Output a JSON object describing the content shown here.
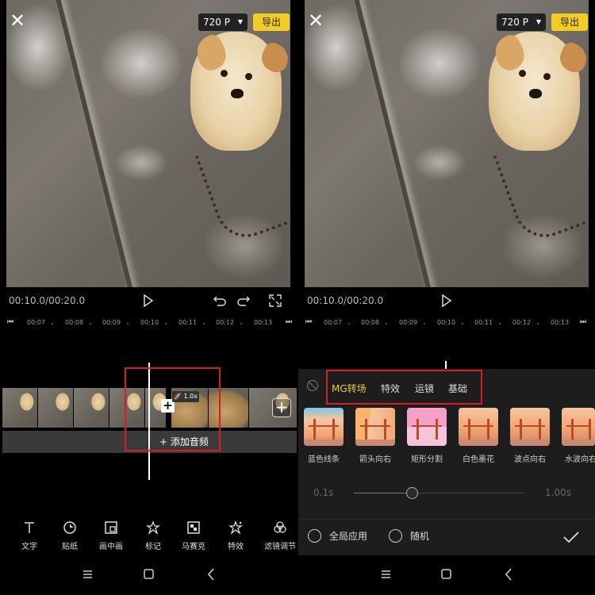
{
  "left": {
    "header": {
      "resolution": "720 P",
      "export_label": "导出"
    },
    "player": {
      "time": "00:10.0/00:20.0"
    },
    "ruler": {
      "ticks": [
        "00:07",
        "00:08",
        "00:09",
        "00:10",
        "00:11",
        "00:12",
        "00:13"
      ]
    },
    "timeline": {
      "speed_badge": "1.0x",
      "add_audio": "+ 添加音频"
    },
    "toolbar": {
      "items": [
        {
          "label": "文字",
          "icon": "text-icon"
        },
        {
          "label": "贴纸",
          "icon": "sticker-icon"
        },
        {
          "label": "画中画",
          "icon": "pip-icon"
        },
        {
          "label": "标记",
          "icon": "mark-icon"
        },
        {
          "label": "马赛克",
          "icon": "mosaic-icon"
        },
        {
          "label": "特效",
          "icon": "effect-icon"
        },
        {
          "label": "滤镜调节",
          "icon": "filter-icon"
        }
      ]
    }
  },
  "right": {
    "header": {
      "resolution": "720 P",
      "export_label": "导出"
    },
    "player": {
      "time": "00:10.0/00:20.0"
    },
    "ruler": {
      "ticks": [
        "00:07",
        "00:08",
        "00:09",
        "00:10",
        "00:11",
        "00:12",
        "00:13"
      ]
    },
    "transitions": {
      "tabs": [
        {
          "label": "MG转场",
          "active": true
        },
        {
          "label": "特效",
          "active": false
        },
        {
          "label": "运镜",
          "active": false
        },
        {
          "label": "基础",
          "active": false
        }
      ],
      "items": [
        "蓝色线条",
        "箭头向右",
        "矩形分割",
        "白色墨花",
        "波点向右",
        "水波向右"
      ],
      "duration_min": "0.1s",
      "duration_max": "1.00s",
      "duration_value_fraction": 0.34,
      "apply_all_label": "全局应用",
      "random_label": "随机"
    }
  },
  "colors": {
    "accent": "#f2cd26",
    "highlight_box": "#d41e26",
    "sheet_bg": "#1d1d1d"
  }
}
